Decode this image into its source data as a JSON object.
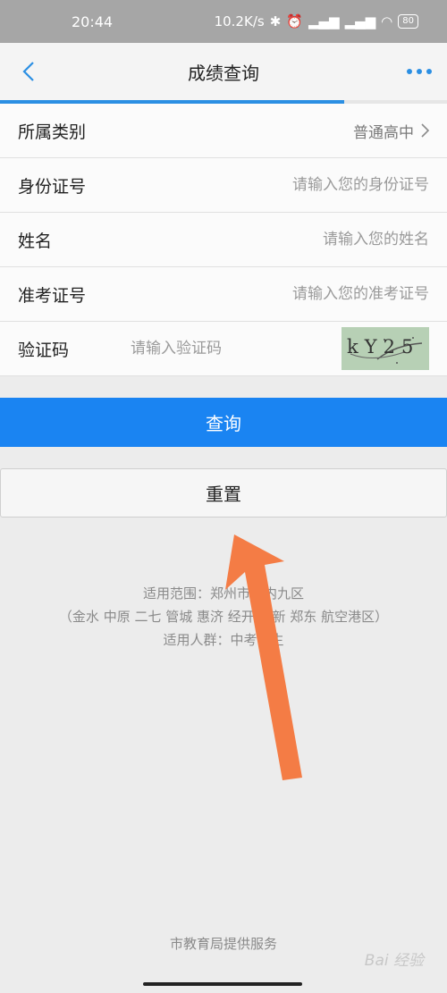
{
  "status_bar": {
    "time": "20:44",
    "network_speed": "10.2K/s",
    "battery": "80"
  },
  "nav": {
    "title": "成绩查询",
    "progress_fraction": 0.77
  },
  "form": {
    "category_label": "所属类别",
    "category_value": "普通高中",
    "id_label": "身份证号",
    "id_placeholder": "请输入您的身份证号",
    "name_label": "姓名",
    "name_placeholder": "请输入您的姓名",
    "exam_label": "准考证号",
    "exam_placeholder": "请输入您的准考证号",
    "captcha_label": "验证码",
    "captcha_placeholder": "请输入验证码",
    "captcha_image_text": "kY25"
  },
  "buttons": {
    "query": "查询",
    "reset": "重置"
  },
  "notice": {
    "line1": "适用范围：郑州市市内九区",
    "line2": "（金水 中原 二七 管城 惠济 经开 高新 郑东 航空港区）",
    "line3": "适用人群：中考考生"
  },
  "footer": "市教育局提供服务",
  "watermark": "Bai 经验",
  "colors": {
    "accent": "#1a84f2",
    "progress": "#2b8fe3",
    "arrow": "#f47c45"
  }
}
